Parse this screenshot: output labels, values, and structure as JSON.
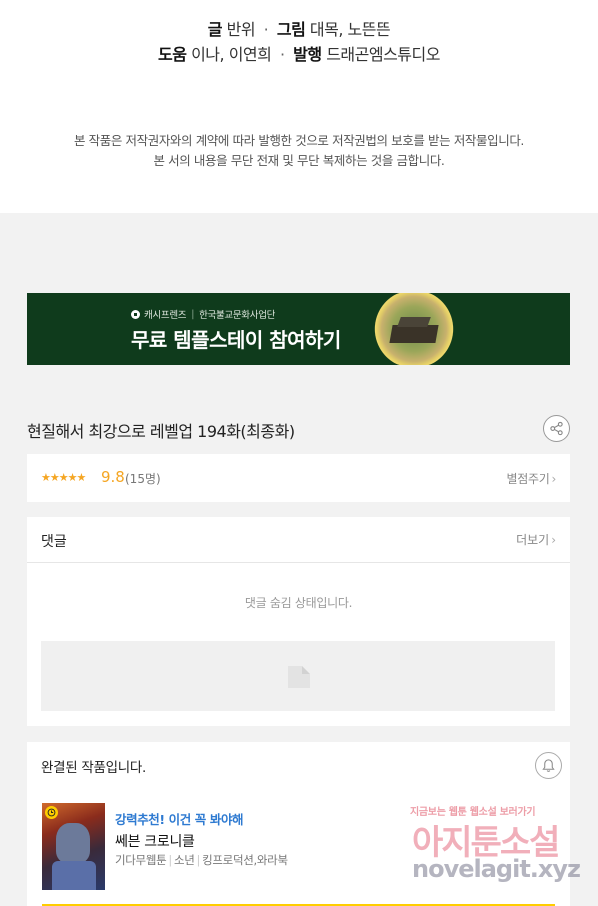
{
  "credits": {
    "writer_label": "글",
    "writer": "반위",
    "art_label": "그림",
    "art": "대목, 노뜬뜬",
    "assist_label": "도움",
    "assist": "이나, 이연희",
    "publisher_label": "발행",
    "publisher": "드래곤엠스튜디오",
    "separator": "·"
  },
  "copyright": {
    "line1": "본 작품은 저작권자와의 계약에 따라 발행한 것으로 저작권법의 보호를 받는 저작물입니다.",
    "line2": "본 서의 내용을 무단 전재 및 무단 복제하는 것을 금합니다."
  },
  "banner": {
    "sponsor": "캐시프렌즈",
    "partner": "한국불교문화사업단",
    "title": "무료 템플스테이 참여하기",
    "background": "#0f3b1c"
  },
  "episode": {
    "title": "현질해서 최강으로 레벨업 194화(최종화)"
  },
  "rating": {
    "stars": "★★★★★",
    "score": "9.8",
    "count": "(15명)",
    "rate_label": "별점주기",
    "star_color": "#f5a623"
  },
  "comments": {
    "label": "댓글",
    "more_label": "더보기",
    "hidden_message": "댓글 숨김 상태입니다."
  },
  "completed": {
    "label": "완결된 작품입니다."
  },
  "recommendation": {
    "tag": "강력추천! 이건 꼭 봐야해",
    "title": "쎄븐 크로니클",
    "genre": "기다무웹툰",
    "category": "소년",
    "author": "킹프로덕션,와라북",
    "tag_color": "#2e7ad1",
    "accent": "#ffcd00"
  },
  "watermark": {
    "tagline": "지금보는 웹툰 웹소설 보러가기",
    "name": "아지툰소설",
    "url": "novelagit.xyz"
  }
}
